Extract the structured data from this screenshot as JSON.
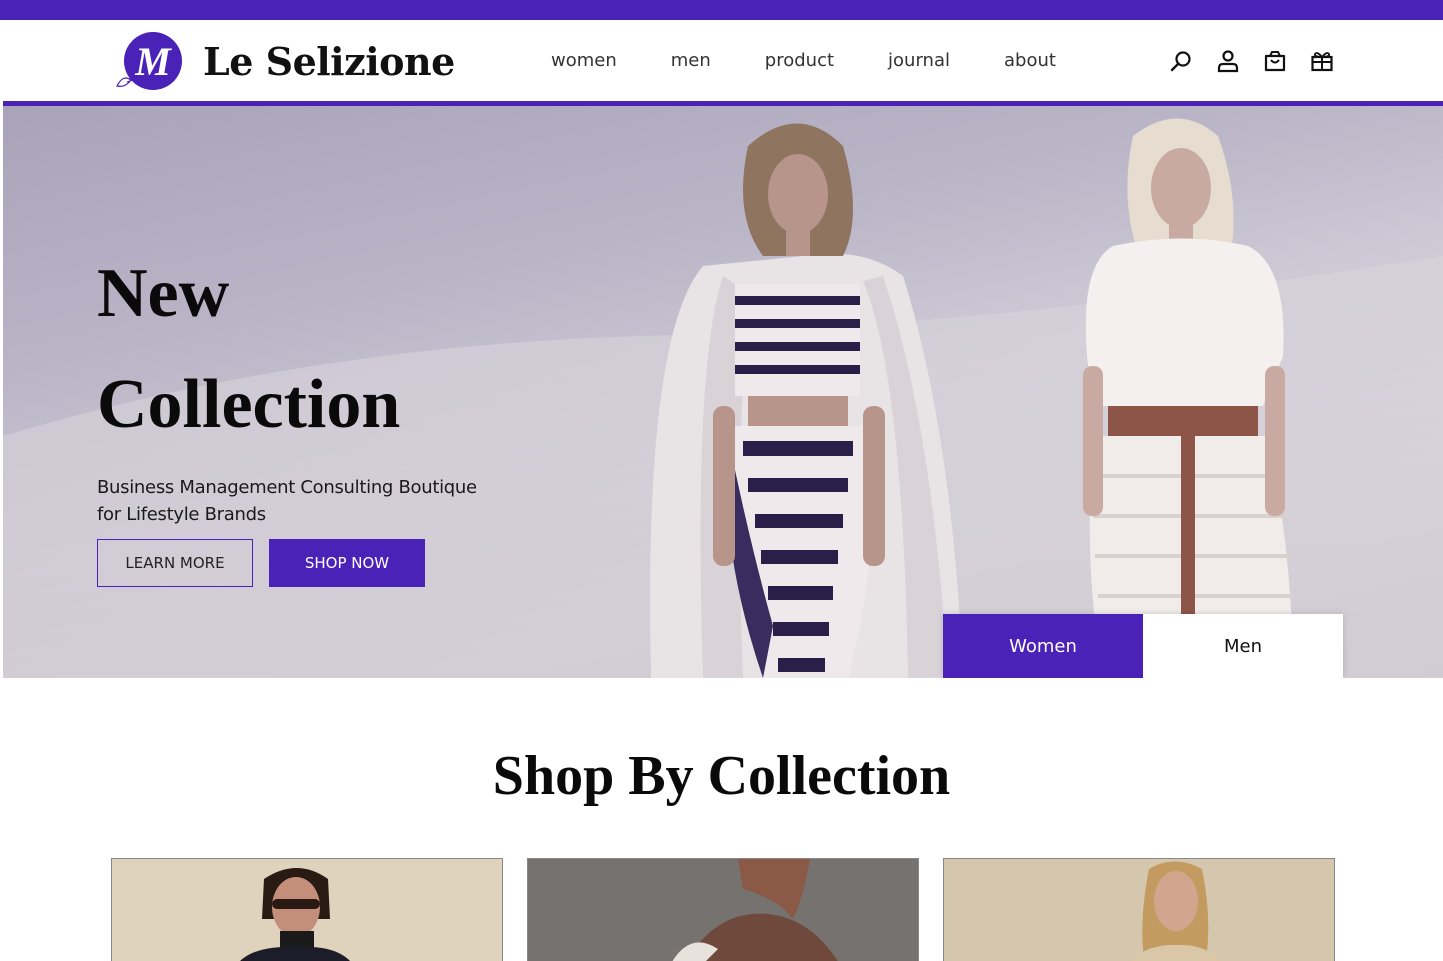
{
  "brand": {
    "name": "Le Selizione",
    "logo_letter": "M",
    "accent_color": "#4a22b8"
  },
  "nav": {
    "items": [
      "women",
      "men",
      "product",
      "journal",
      "about"
    ]
  },
  "header_icons": [
    "search-icon",
    "user-icon",
    "shopping-bag-icon",
    "gift-icon"
  ],
  "hero": {
    "title_line1": "New",
    "title_line2": "Collection",
    "subtitle": "Business Management Consulting Boutique for Lifestyle Brands",
    "learn_more_label": "LEARN MORE",
    "shop_now_label": "SHOP NOW",
    "tabs": [
      {
        "label": "Women",
        "active": true
      },
      {
        "label": "Men",
        "active": false
      }
    ]
  },
  "collections": {
    "title": "Shop By Collection",
    "cards": [
      {
        "image": "collection-image-woman-sunglasses"
      },
      {
        "image": "collection-image-model-fur"
      },
      {
        "image": "collection-image-model-blazer"
      }
    ]
  }
}
